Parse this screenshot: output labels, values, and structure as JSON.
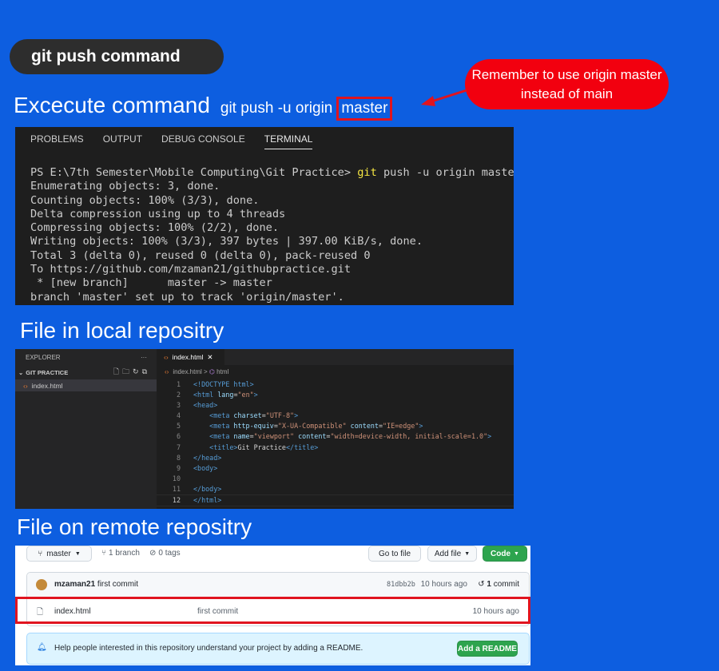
{
  "slide": {
    "pill_title": "git push  command",
    "callout": "Remember to use origin master instead of main",
    "heading_big": "Excecute command",
    "heading_cmd": "git push -u origin",
    "heading_boxed": "master",
    "section_local": "File in local repositry",
    "section_remote": "File on remote repositry"
  },
  "terminal": {
    "tabs": [
      "PROBLEMS",
      "OUTPUT",
      "DEBUG CONSOLE",
      "TERMINAL"
    ],
    "prompt": "PS E:\\7th Semester\\Mobile Computing\\Git Practice> ",
    "cmd_git": "git",
    "cmd_rest": " push -u origin master",
    "lines": [
      "Enumerating objects: 3, done.",
      "Counting objects: 100% (3/3), done.",
      "Delta compression using up to 4 threads",
      "Compressing objects: 100% (2/2), done.",
      "Writing objects: 100% (3/3), 397 bytes | 397.00 KiB/s, done.",
      "Total 3 (delta 0), reused 0 (delta 0), pack-reused 0",
      "To https://github.com/mzaman21/githubpractice.git",
      " * [new branch]      master -> master",
      "branch 'master' set up to track 'origin/master'."
    ]
  },
  "editor": {
    "explorer_label": "EXPLORER",
    "explorer_more": "···",
    "folder": "GIT PRACTICE",
    "file": "index.html",
    "tab": "index.html",
    "crumb_file": "index.html",
    "crumb_sep": " > ",
    "crumb_sym": "html",
    "line_numbers": [
      "1",
      "2",
      "3",
      "4",
      "5",
      "6",
      "7",
      "8",
      "9",
      "10",
      "11",
      "12"
    ],
    "code": {
      "l1": "<!DOCTYPE html>",
      "l2_open": "<html",
      "l2_attr": " lang",
      "l2_val": "\"en\"",
      "l3": "<head>",
      "l4_tag": "<meta",
      "l4_attr": " charset",
      "l4_val": "\"UTF-8\"",
      "l5_tag": "<meta",
      "l5_attr1": " http-equiv",
      "l5_val1": "\"X-UA-Compatible\"",
      "l5_attr2": " content",
      "l5_val2": "\"IE=edge\"",
      "l6_tag": "<meta",
      "l6_attr1": " name",
      "l6_val1": "\"viewport\"",
      "l6_attr2": " content",
      "l6_val2": "\"width=device-width, initial-scale=1.0\"",
      "l7_open": "<title>",
      "l7_text": "Git Practice",
      "l7_close": "</title>",
      "l8": "</head>",
      "l9": "<body>",
      "l11": "</body>",
      "l12": "</html>"
    }
  },
  "github": {
    "branch_btn": "master",
    "branches": "1 branch",
    "tags": "0 tags",
    "go_to_file": "Go to file",
    "add_file": "Add file",
    "code_btn": "Code",
    "commit_author": "mzaman21",
    "commit_msg": "first commit",
    "commit_hash": "81dbb2b",
    "commit_time": "10 hours ago",
    "commit_count": "1",
    "commit_word": "commit",
    "file_name": "index.html",
    "file_commit": "first commit",
    "file_time": "10 hours ago",
    "readme_text": "Help people interested in this repository understand your project by adding a README.",
    "readme_btn": "Add a README"
  }
}
